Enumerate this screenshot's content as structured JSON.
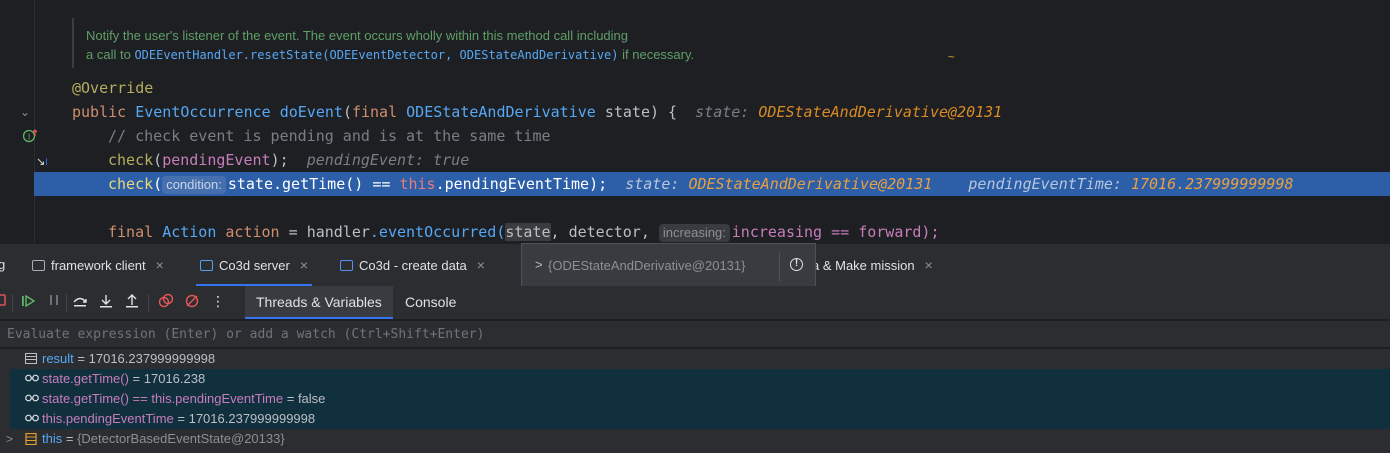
{
  "editor": {
    "doc_line1": "Notify the user's listener of the event. The event occurs wholly within this method call including",
    "doc_line2_prefix": "a call to",
    "doc_line2_code": "ODEEventHandler.resetState(ODEEventDetector, ODEStateAndDerivative)",
    "doc_line2_suffix": "if necessary.",
    "tilde": "~",
    "annotation": "@Override",
    "sig_public": "public",
    "sig_type": "EventOccurrence",
    "sig_method": "doEvent",
    "sig_open": "(",
    "sig_final": "final",
    "sig_param_type": "ODEStateAndDerivative",
    "sig_param_name": "state",
    "sig_close": ") {",
    "sig_hint_key": "state:",
    "sig_hint_val": "ODEStateAndDerivative@20131",
    "comment": "// check event is pending and is at the same time",
    "check1_fn": "check",
    "check1_open": "(",
    "check1_arg": "pendingEvent",
    "check1_close": ");",
    "check1_hint_key": "pendingEvent:",
    "check1_hint_val": "true",
    "check2_fn": "check",
    "check2_open": "(",
    "check2_pill": "condition:",
    "check2_state": "state",
    "check2_call": ".getTime() == ",
    "check2_this": "this",
    "check2_field": ".pendingEventTime);",
    "check2_hint1_key": "state:",
    "check2_hint1_val": "ODEStateAndDerivative@20131",
    "check2_hint2_key": "pendingEventTime:",
    "check2_hint2_val": "17016.237999999998",
    "action_final": "final",
    "action_type": "Action",
    "action_var": "action",
    "action_eq": " = ",
    "action_handler": "handler",
    "action_call": ".eventOccurred(",
    "action_state": "state",
    "action_mid": ", detector, ",
    "action_pill": "increasing:",
    "action_rest": "increasing == forward);"
  },
  "tabs": [
    {
      "label": "g"
    },
    {
      "label": "framework client",
      "close": "×"
    },
    {
      "label": "Co3d server",
      "close": "×",
      "active": true
    },
    {
      "label": "Co3d - create data",
      "close": "×"
    },
    {
      "label": "a & Make mission",
      "close": "×"
    }
  ],
  "tooltip": {
    "chevron": ">",
    "value": "{ODEStateAndDerivative@20131}",
    "warn": "!"
  },
  "toolbar": {
    "subtabs": [
      "Threads & Variables",
      "Console"
    ],
    "more": "⋮"
  },
  "eval": {
    "placeholder": "Evaluate expression (Enter) or add a watch (Ctrl+Shift+Enter)"
  },
  "variables": [
    {
      "name": "result",
      "eq": " = ",
      "value": "17016.237999999998",
      "icon": "result-icon"
    },
    {
      "name": "state.getTime()",
      "eq": " = ",
      "value": "17016.238",
      "icon": "watch-icon"
    },
    {
      "name": "state.getTime() == this.pendingEventTime",
      "eq": " = ",
      "value": "false",
      "icon": "watch-icon"
    },
    {
      "name": "this.pendingEventTime",
      "eq": " = ",
      "value": "17016.237999999998",
      "icon": "watch-icon"
    },
    {
      "name": "this",
      "eq": " = ",
      "value": "{DetectorBasedEventState@20133}",
      "icon": "object-icon",
      "expander": ">"
    }
  ],
  "colors": {
    "background": "#1e1f22",
    "panel": "#2b2d30",
    "execution_line": "#2d5fa8",
    "accent": "#3574f0",
    "keyword": "#cf8e6d",
    "inlay_value": "#d98b24"
  }
}
